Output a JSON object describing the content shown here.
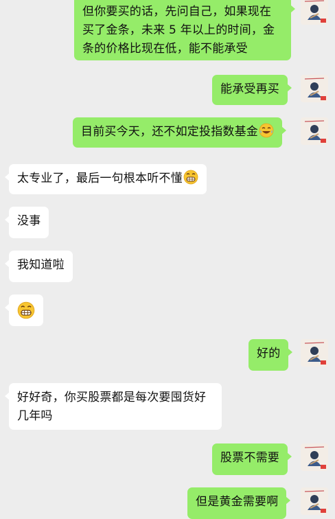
{
  "messages": [
    {
      "from": "me",
      "text": "但你要买的话，先问自己，如果现在买了金条，未来 5 年以上的时间，金条的价格比现在低，能不能承受"
    },
    {
      "from": "me",
      "text": "能承受再买"
    },
    {
      "from": "me",
      "text": "目前买今天，还不如定投指数基金",
      "emoji": "laughing-tears-icon"
    },
    {
      "from": "other",
      "text": "太专业了，最后一句根本听不懂",
      "emoji": "grimace-icon"
    },
    {
      "from": "other",
      "text": "没事"
    },
    {
      "from": "other",
      "text": "我知道啦"
    },
    {
      "from": "other",
      "text": "",
      "emoji": "grimace-icon"
    },
    {
      "from": "me",
      "text": "好的"
    },
    {
      "from": "other",
      "text": "好好奇，你买股票都是每次要囤货好几年吗"
    },
    {
      "from": "me",
      "text": "股票不需要"
    },
    {
      "from": "me",
      "text": "但是黄金需要啊"
    }
  ],
  "colors": {
    "me_bubble": "#95ec69",
    "other_bubble": "#ffffff",
    "background": "#ededed"
  }
}
